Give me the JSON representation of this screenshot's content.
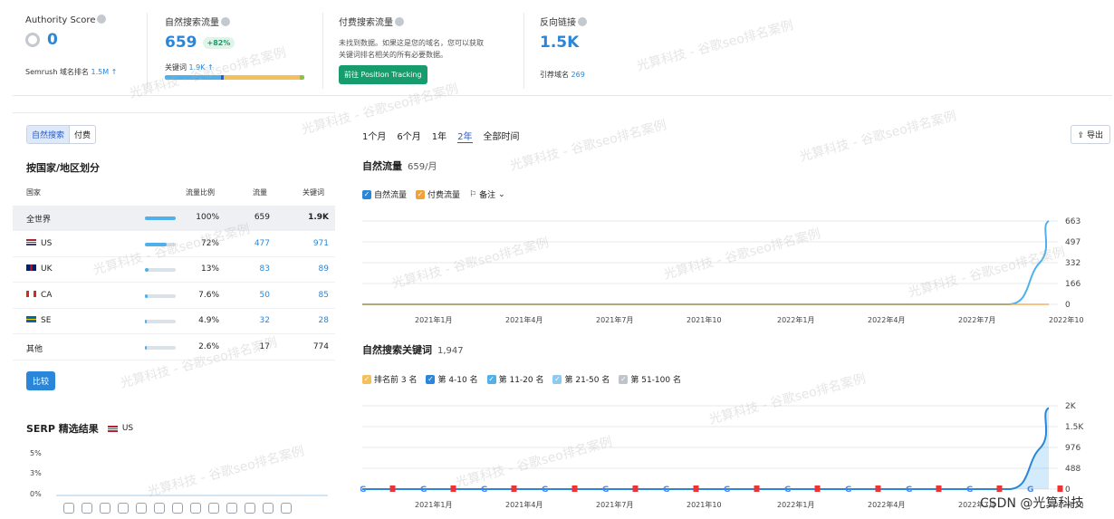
{
  "kpis": {
    "authority": {
      "label": "Authority Score",
      "value": "0",
      "rank_label": "Semrush 域名排名",
      "rank_value": "1.5M ↑"
    },
    "organic": {
      "label": "自然搜索流量",
      "value": "659",
      "change": "+82%",
      "kw_label": "关键词",
      "kw_value": "1.9K ↑"
    },
    "paid": {
      "label": "付费搜索流量",
      "desc_line1": "未找到数据。如果这是您的域名，您可以获取",
      "desc_line2": "关键词排名相关的所有必要数据。",
      "button": "前往 Position Tracking"
    },
    "backlinks": {
      "label": "反向链接",
      "value": "1.5K",
      "ref_label": "引荐域名",
      "ref_value": "269"
    }
  },
  "left": {
    "tabs": [
      "自然搜索",
      "付费"
    ],
    "title": "按国家/地区划分",
    "headers": [
      "国家",
      "流量比例",
      "流量",
      "关键词"
    ],
    "rows": [
      {
        "name": "全世界",
        "pct": "100%",
        "share": 1.0,
        "traffic": "659",
        "kw": "1.9K"
      },
      {
        "name": "US",
        "pct": "72%",
        "share": 0.72,
        "traffic": "477",
        "kw": "971"
      },
      {
        "name": "UK",
        "pct": "13%",
        "share": 0.13,
        "traffic": "83",
        "kw": "89"
      },
      {
        "name": "CA",
        "pct": "7.6%",
        "share": 0.076,
        "traffic": "50",
        "kw": "85"
      },
      {
        "name": "SE",
        "pct": "4.9%",
        "share": 0.049,
        "traffic": "32",
        "kw": "28"
      },
      {
        "name": "其他",
        "pct": "2.6%",
        "share": 0.026,
        "traffic": "17",
        "kw": "774"
      }
    ],
    "compare": "比较",
    "serp_title": "SERP 精选结果",
    "serp_country": "US",
    "serp_ticks": [
      "5%",
      "3%",
      "0%"
    ]
  },
  "periods": [
    "1个月",
    "6个月",
    "1年",
    "2年",
    "全部时间"
  ],
  "export": "导出",
  "traffic_chart": {
    "title": "自然流量",
    "subtitle": "659/月",
    "legend": [
      "自然流量",
      "付费流量",
      "备注"
    ],
    "yticks": [
      "663",
      "497",
      "332",
      "166",
      "0"
    ],
    "xticks": [
      "2021年1月",
      "2021年4月",
      "2021年7月",
      "2021年10",
      "2022年1月",
      "2022年4月",
      "2022年7月",
      "2022年10"
    ]
  },
  "kw_chart": {
    "title": "自然搜索关键词",
    "subtitle": "1,947",
    "legend": [
      "排名前 3 名",
      "第 4-10 名",
      "第 11-20 名",
      "第 21-50 名",
      "第 51-100 名"
    ],
    "yticks": [
      "2K",
      "1.5K",
      "976",
      "488",
      "0"
    ],
    "xticks": [
      "2021年1月",
      "2021年4月",
      "2021年7月",
      "2021年10",
      "2022年1月",
      "2022年4月",
      "2022年7月",
      "2022年10"
    ]
  },
  "chart_data": [
    {
      "type": "line",
      "title": "自然流量",
      "x": [
        "2021年1月",
        "2021年4月",
        "2021年7月",
        "2021年10",
        "2022年1月",
        "2022年4月",
        "2022年7月",
        "2022年10"
      ],
      "series": [
        {
          "name": "自然流量",
          "values": [
            0,
            0,
            0,
            0,
            0,
            0,
            0,
            663
          ]
        },
        {
          "name": "付费流量",
          "values": [
            0,
            0,
            0,
            0,
            0,
            0,
            0,
            0
          ]
        }
      ],
      "ylim": [
        0,
        663
      ]
    },
    {
      "type": "area",
      "title": "自然搜索关键词",
      "x": [
        "2021年1月",
        "2021年4月",
        "2021年7月",
        "2021年10",
        "2022年1月",
        "2022年4月",
        "2022年7月",
        "2022年10"
      ],
      "series": [
        {
          "name": "第 4-10 名",
          "values": [
            0,
            0,
            0,
            0,
            0,
            0,
            0,
            1947
          ]
        }
      ],
      "ylim": [
        0,
        2000
      ]
    }
  ],
  "colors": {
    "accent": "#2a86d8",
    "green": "#179c6e",
    "orange": "#f0a23c"
  },
  "watermark": "光算科技 - 谷歌seo排名案例",
  "footer": "CSDN @光算科技"
}
